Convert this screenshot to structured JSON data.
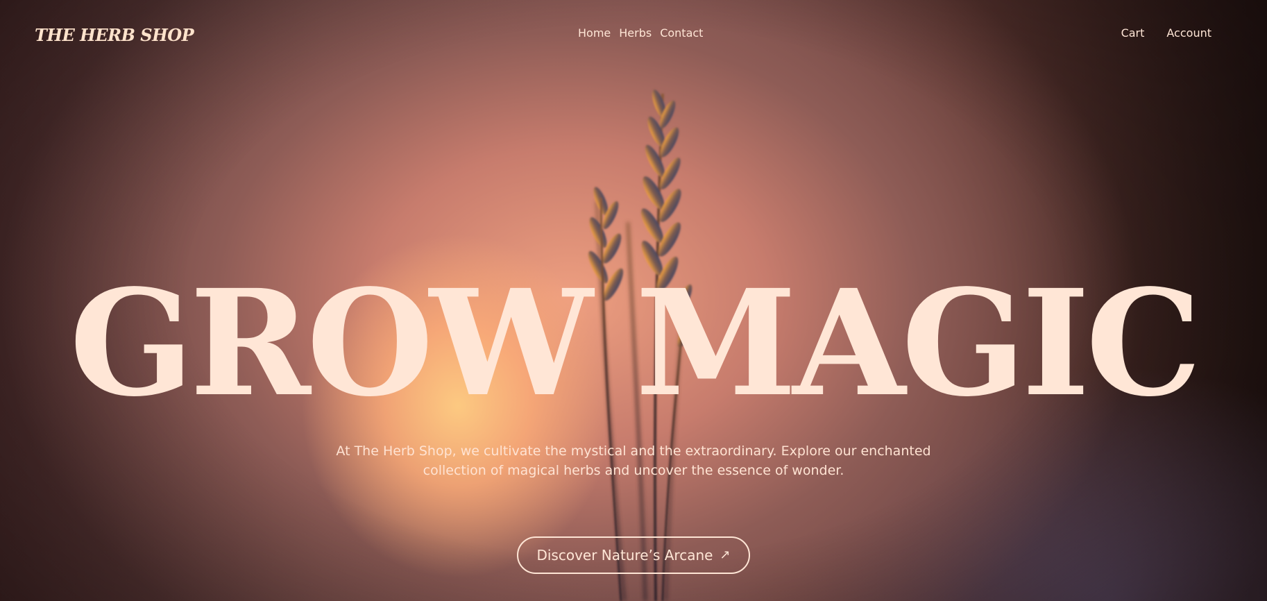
{
  "header": {
    "logo": "THE HERB SHOP",
    "nav_center": [
      {
        "label": "Home"
      },
      {
        "label": "Herbs"
      },
      {
        "label": "Contact"
      }
    ],
    "nav_right": [
      {
        "label": "Cart"
      },
      {
        "label": "Account"
      }
    ]
  },
  "hero": {
    "headline": "GROW MAGIC",
    "description": "At The Herb Shop, we cultivate the mystical and the extraordinary. Explore our enchanted collection of magical herbs and uncover the essence of wonder.",
    "cta_label": "Discover Nature’s Arcane",
    "cta_icon": "arrow-up-right-icon"
  },
  "colors": {
    "text": "#ffe6d6",
    "glow": "#ffc98a",
    "background_dark": "#2a1a17"
  }
}
